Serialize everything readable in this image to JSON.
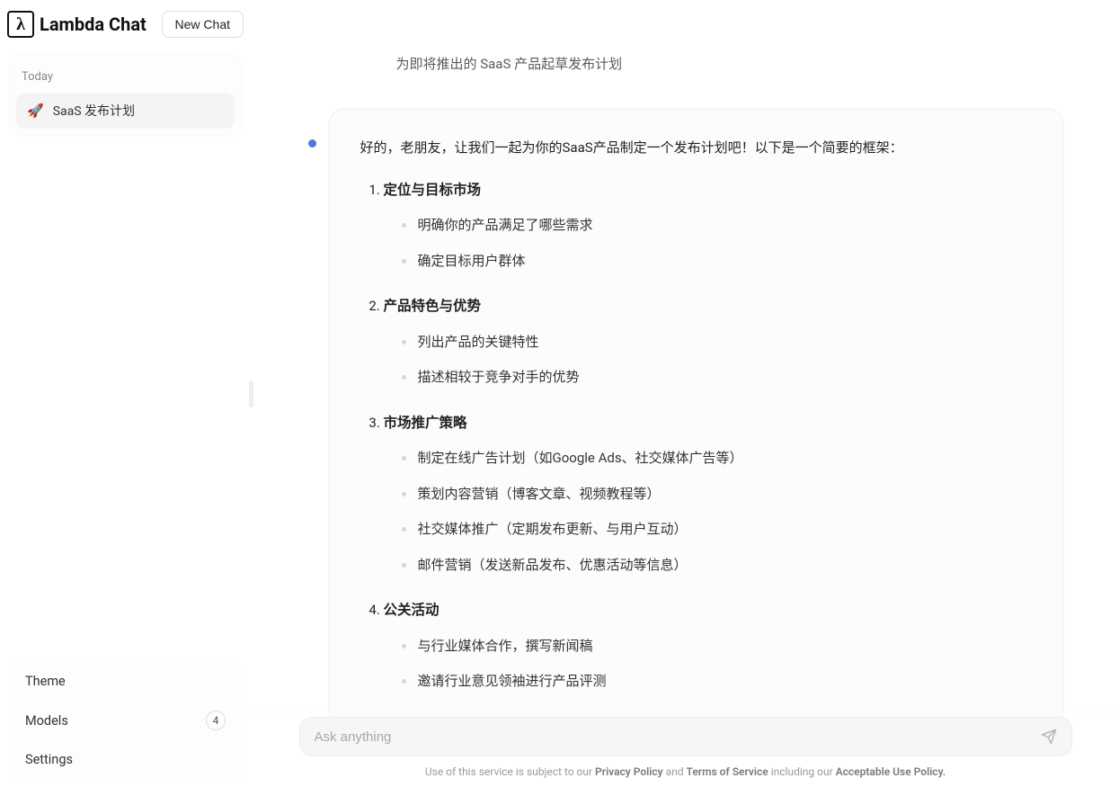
{
  "app": {
    "name": "Lambda Chat",
    "logo_glyph": "λ",
    "new_chat_label": "New Chat"
  },
  "sidebar": {
    "section_label": "Today",
    "chats": [
      {
        "emoji": "🚀",
        "title": "SaaS 发布计划"
      }
    ],
    "footer": {
      "theme": "Theme",
      "models": "Models",
      "models_count": "4",
      "settings": "Settings"
    }
  },
  "conversation": {
    "user_message": "为即将推出的 SaaS 产品起草发布计划",
    "assistant": {
      "intro": "好的，老朋友，让我们一起为你的SaaS产品制定一个发布计划吧！以下是一个简要的框架：",
      "sections": [
        {
          "title": "定位与目标市场",
          "bullets": [
            "明确你的产品满足了哪些需求",
            "确定目标用户群体"
          ]
        },
        {
          "title": "产品特色与优势",
          "bullets": [
            "列出产品的关键特性",
            "描述相较于竞争对手的优势"
          ]
        },
        {
          "title": "市场推广策略",
          "bullets": [
            "制定在线广告计划（如Google Ads、社交媒体广告等）",
            "策划内容营销（博客文章、视频教程等）",
            "社交媒体推广（定期发布更新、与用户互动）",
            "邮件营销（发送新品发布、优惠活动等信息）"
          ]
        },
        {
          "title": "公关活动",
          "bullets": [
            "与行业媒体合作，撰写新闻稿",
            "邀请行业意见领袖进行产品评测"
          ]
        }
      ]
    }
  },
  "composer": {
    "placeholder": "Ask anything"
  },
  "disclaimer": {
    "prefix": "Use of this service is subject to our ",
    "privacy": "Privacy Policy",
    "middle": " and ",
    "terms": "Terms of Service",
    "suffix": " including our ",
    "aup": "Acceptable Use Policy."
  }
}
